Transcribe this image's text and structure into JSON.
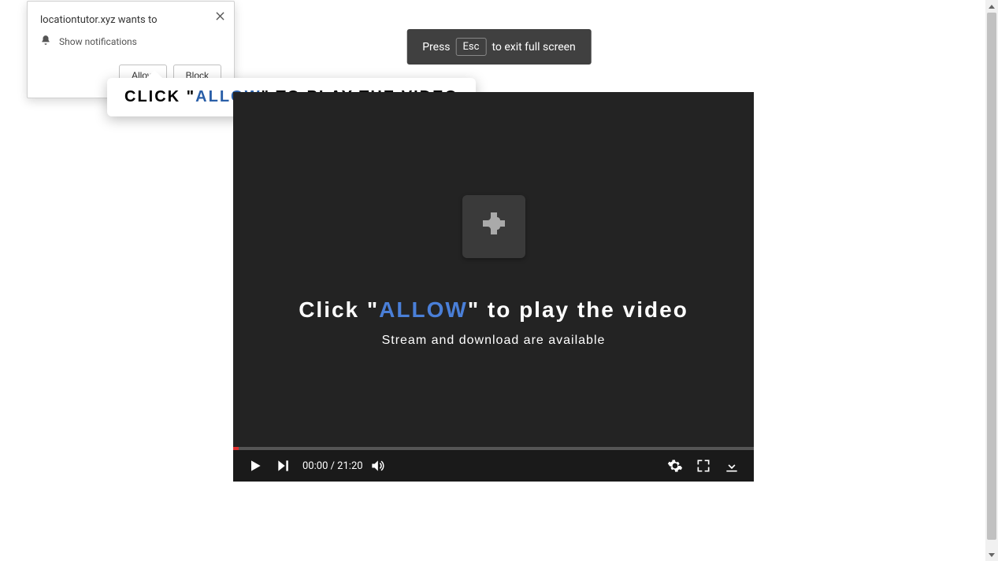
{
  "esc_banner": {
    "pre": "Press",
    "key": "Esc",
    "post": "to exit full screen"
  },
  "permission": {
    "title": "locationtutor.xyz wants to",
    "type": "Show notifications",
    "allow": "Allow",
    "block": "Block"
  },
  "tooltip": {
    "pre": "CLICK \"",
    "allow": "ALLOW",
    "post": "\" TO PLAY THE VIDEO"
  },
  "video": {
    "msg_pre": "Click \"",
    "msg_allow": "ALLOW",
    "msg_post": "\" to play the video",
    "sub": "Stream and download are available",
    "time": "00:00 / 21:20"
  }
}
